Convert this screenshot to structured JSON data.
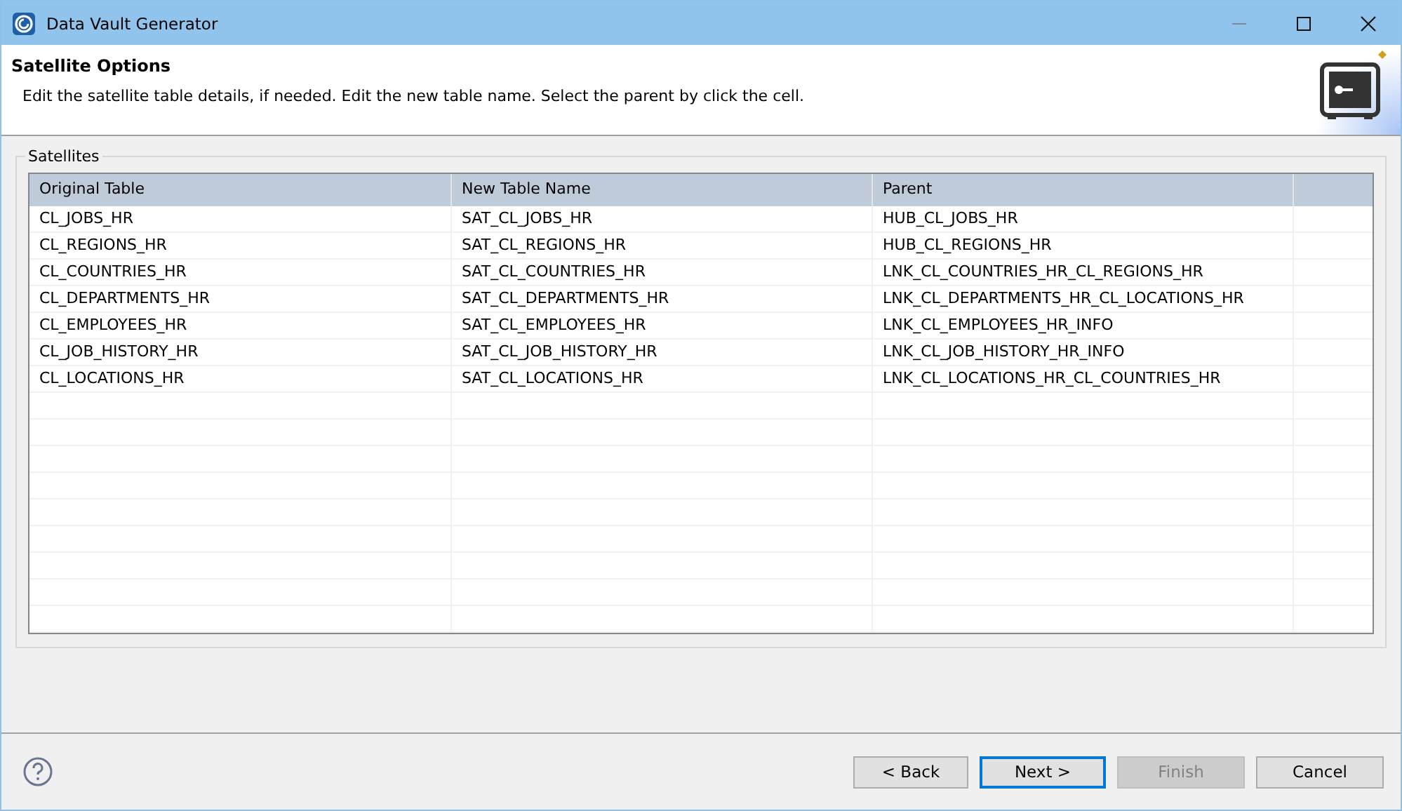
{
  "window": {
    "title": "Data Vault Generator"
  },
  "header": {
    "title": "Satellite Options",
    "description": "Edit the satellite table details, if needed. Edit the new table name. Select the parent by click the cell."
  },
  "group": {
    "label": "Satellites"
  },
  "table": {
    "columns": [
      "Original Table",
      "New Table Name",
      "Parent"
    ],
    "rows": [
      [
        "CL_JOBS_HR",
        "SAT_CL_JOBS_HR",
        "HUB_CL_JOBS_HR"
      ],
      [
        "CL_REGIONS_HR",
        "SAT_CL_REGIONS_HR",
        "HUB_CL_REGIONS_HR"
      ],
      [
        "CL_COUNTRIES_HR",
        "SAT_CL_COUNTRIES_HR",
        "LNK_CL_COUNTRIES_HR_CL_REGIONS_HR"
      ],
      [
        "CL_DEPARTMENTS_HR",
        "SAT_CL_DEPARTMENTS_HR",
        "LNK_CL_DEPARTMENTS_HR_CL_LOCATIONS_HR"
      ],
      [
        "CL_EMPLOYEES_HR",
        "SAT_CL_EMPLOYEES_HR",
        "LNK_CL_EMPLOYEES_HR_INFO"
      ],
      [
        "CL_JOB_HISTORY_HR",
        "SAT_CL_JOB_HISTORY_HR",
        "LNK_CL_JOB_HISTORY_HR_INFO"
      ],
      [
        "CL_LOCATIONS_HR",
        "SAT_CL_LOCATIONS_HR",
        "LNK_CL_LOCATIONS_HR_CL_COUNTRIES_HR"
      ]
    ]
  },
  "buttons": [
    {
      "label": "< Back",
      "disabled": false,
      "default": false
    },
    {
      "label": "Next >",
      "disabled": false,
      "default": true
    },
    {
      "label": "Finish",
      "disabled": true,
      "default": false
    },
    {
      "label": "Cancel",
      "disabled": false,
      "default": false
    }
  ]
}
